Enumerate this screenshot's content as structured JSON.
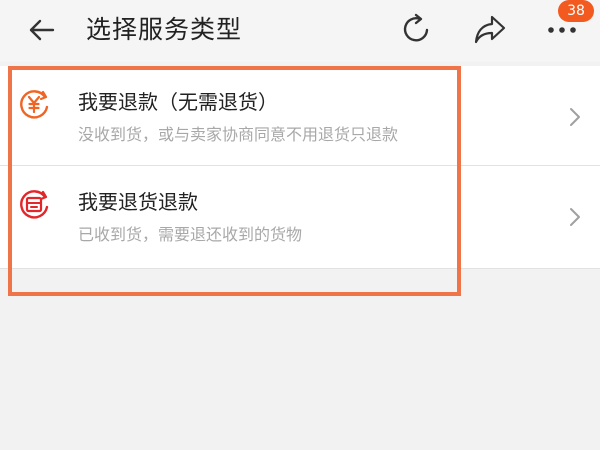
{
  "header": {
    "title": "选择服务类型",
    "back_icon": "arrow-left-icon",
    "refresh_icon": "refresh-icon",
    "share_icon": "share-icon",
    "more_icon": "more-dots-icon",
    "badge_count": "38",
    "badge_color": "#f25a1f"
  },
  "options": [
    {
      "title": "我要退款（无需退货）",
      "subtitle": "没收到货，或与卖家协商同意不用退货只退款",
      "icon": "yen-refund-icon",
      "icon_color": "#f06424"
    },
    {
      "title": "我要退货退款",
      "subtitle": "已收到货，需要退还收到的货物",
      "icon": "return-box-icon",
      "icon_color": "#e2262a"
    }
  ],
  "highlight_color": "#ef7448"
}
